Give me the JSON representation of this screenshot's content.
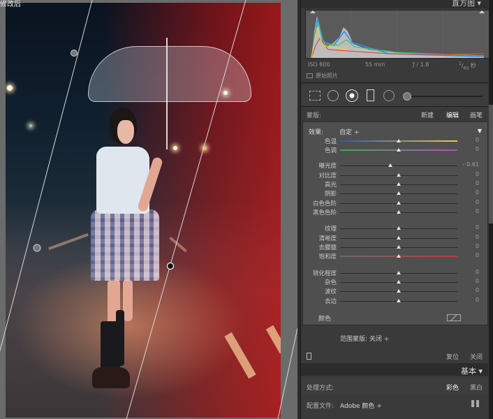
{
  "photo": {
    "caption": "修改后"
  },
  "histogram": {
    "title": "直方图",
    "iso": "ISO 800",
    "focal": "55 mm",
    "aperture": "ƒ / 1.8",
    "shutter_num": "1",
    "shutter_den": "60",
    "shutter_unit": "秒",
    "original_photo_label": "原始照片"
  },
  "mask_header": {
    "label": "蒙版:",
    "new": "新建",
    "edit": "编辑",
    "brush": "画笔"
  },
  "effect": {
    "label": "效果:",
    "preset": "自定 ÷"
  },
  "sliders": [
    {
      "label": "色温",
      "value": "0",
      "pos": 0.5
    },
    {
      "label": "色调",
      "value": "0",
      "pos": 0.5
    },
    {
      "label": "曝光度",
      "value": "– 0.61",
      "pos": 0.43
    },
    {
      "label": "对比度",
      "value": "0",
      "pos": 0.5
    },
    {
      "label": "高光",
      "value": "0",
      "pos": 0.5
    },
    {
      "label": "阴影",
      "value": "0",
      "pos": 0.5
    },
    {
      "label": "白色色阶",
      "value": "0",
      "pos": 0.5
    },
    {
      "label": "黑色色阶",
      "value": "0",
      "pos": 0.5
    },
    {
      "label": "纹理",
      "value": "0",
      "pos": 0.5
    },
    {
      "label": "清晰度",
      "value": "0",
      "pos": 0.5
    },
    {
      "label": "去朦胧",
      "value": "0",
      "pos": 0.5
    },
    {
      "label": "饱和度",
      "value": "0",
      "pos": 0.5
    },
    {
      "label": "锐化程度",
      "value": "0",
      "pos": 0.5
    },
    {
      "label": "杂色",
      "value": "0",
      "pos": 0.5
    },
    {
      "label": "波纹",
      "value": "0",
      "pos": 0.5
    },
    {
      "label": "去边",
      "value": "0",
      "pos": 0.5
    }
  ],
  "color_label": "颜色",
  "range_mask": "范围蒙版: 关闭 ÷",
  "bottom": {
    "reset": "复位",
    "close": "关闭"
  },
  "basic": {
    "title": "基本"
  },
  "process": {
    "label": "处理方式:",
    "color": "彩色",
    "bw": "黑白"
  },
  "profile": {
    "label": "配置文件:",
    "value": "Adobe 颜色 ÷"
  },
  "colors": {
    "accent_knob": "#e4e4e4",
    "panel_bg": "#3a3a3a"
  }
}
